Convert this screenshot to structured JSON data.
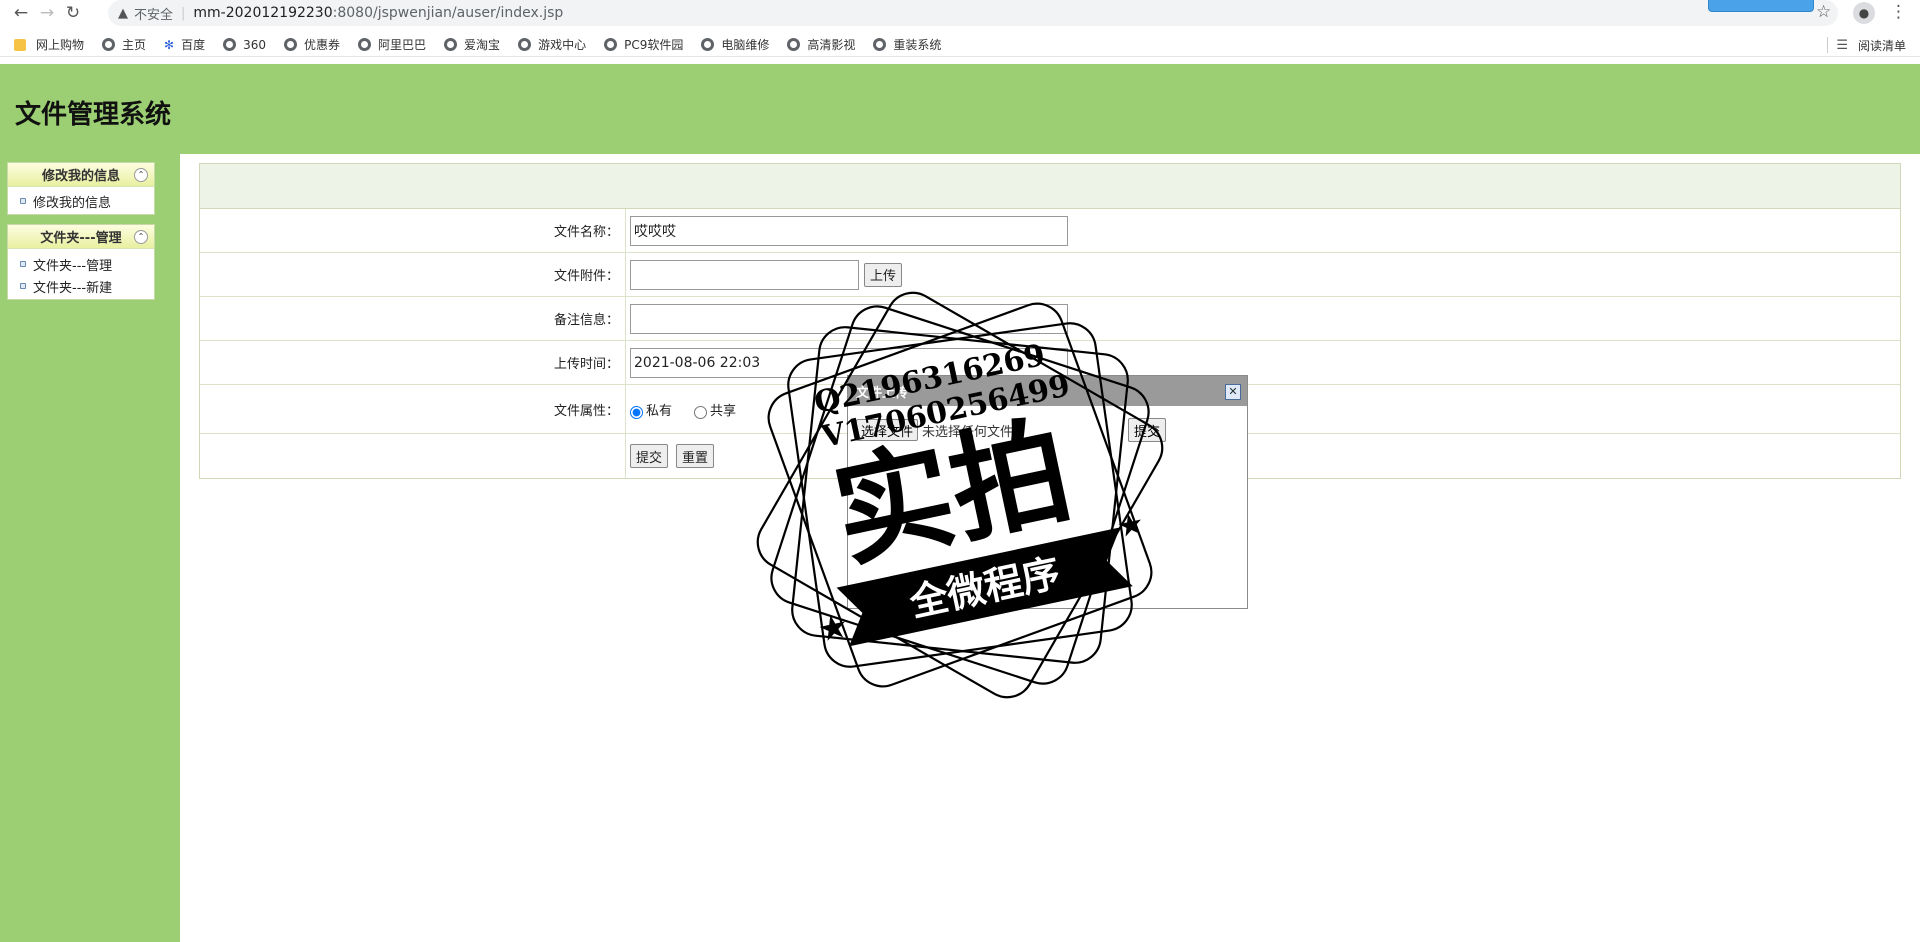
{
  "browser": {
    "insecure_label": "不安全",
    "url_host": "mm-202012192230",
    "url_path": ":8080/jspwenjian/auser/index.jsp",
    "bookmarks": [
      "网上购物",
      "主页",
      "百度",
      "360",
      "优惠券",
      "阿里巴巴",
      "爱淘宝",
      "游戏中心",
      "PC9软件园",
      "电脑维修",
      "高清影视",
      "重装系统"
    ],
    "reading_list": "阅读清单"
  },
  "app": {
    "title": "文件管理系统"
  },
  "sidebar": {
    "panels": [
      {
        "title": "修改我的信息",
        "items": [
          "修改我的信息"
        ]
      },
      {
        "title": "文件夹---管理",
        "items": [
          "文件夹---管理",
          "文件夹---新建"
        ]
      }
    ]
  },
  "form": {
    "name_label": "文件名称：",
    "name_value": "哎哎哎",
    "attach_label": "文件附件：",
    "attach_value": "",
    "upload_button": "上传",
    "note_label": "备注信息：",
    "note_value": "",
    "time_label": "上传时间：",
    "time_value": "2021-08-06 22:03",
    "attr_label": "文件属性：",
    "attr_options": [
      "私有",
      "共享"
    ],
    "attr_selected": "私有",
    "submit_button": "提交",
    "reset_button": "重置"
  },
  "dialog": {
    "title": "文件上传",
    "choose_button": "选择文件",
    "file_status": "未选择任何文件",
    "submit_button": "提交"
  },
  "watermark": {
    "line1": "Q2196316269",
    "line2": "V17060256499",
    "big_text": "实拍",
    "ribbon_text": "全微程序"
  }
}
